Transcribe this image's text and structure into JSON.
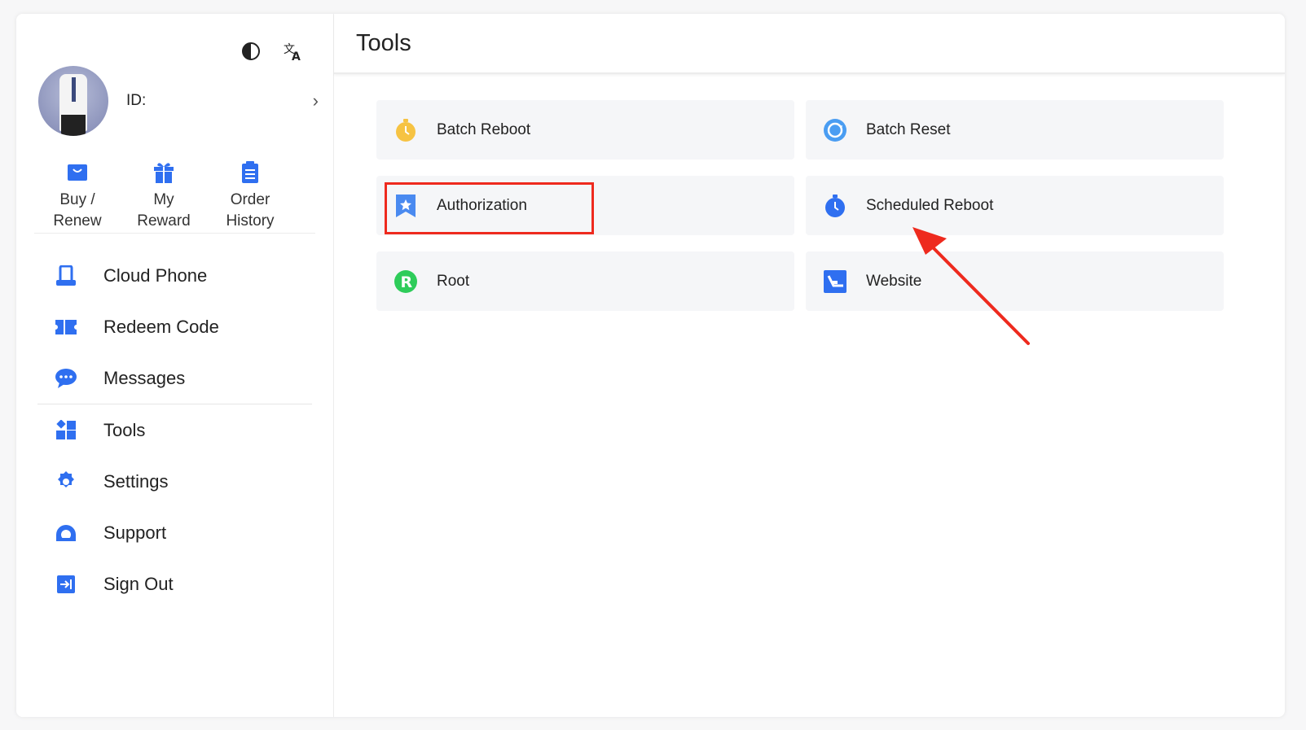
{
  "sidebar": {
    "profile": {
      "id_label": "ID:"
    },
    "quick_actions": [
      {
        "label": "Buy /\nRenew",
        "icon": "shopping-bag-icon"
      },
      {
        "label": "My\nReward",
        "icon": "gift-icon"
      },
      {
        "label": "Order\nHistory",
        "icon": "document-icon"
      }
    ],
    "menu": [
      {
        "label": "Cloud Phone",
        "icon": "cloud-phone-icon"
      },
      {
        "label": "Redeem Code",
        "icon": "ticket-icon"
      },
      {
        "label": "Messages",
        "icon": "chat-bubble-icon"
      },
      {
        "label": "Tools",
        "icon": "tools-grid-icon"
      },
      {
        "label": "Settings",
        "icon": "gear-icon"
      },
      {
        "label": "Support",
        "icon": "headset-icon"
      },
      {
        "label": "Sign Out",
        "icon": "sign-out-icon"
      }
    ],
    "top_icons": [
      "theme-contrast-icon",
      "translate-icon"
    ]
  },
  "main": {
    "title": "Tools",
    "tools": [
      {
        "label": "Batch Reboot",
        "icon": "timer-icon"
      },
      {
        "label": "Batch Reset",
        "icon": "refresh-icon"
      },
      {
        "label": "Authorization",
        "icon": "bookmark-star-icon",
        "highlighted": true
      },
      {
        "label": "Scheduled Reboot",
        "icon": "clock-icon"
      },
      {
        "label": "Root",
        "icon": "root-r-icon"
      },
      {
        "label": "Website",
        "icon": "website-icon"
      }
    ]
  },
  "colors": {
    "accent": "#2f6ff0",
    "highlight": "#ee2a1e",
    "card_bg": "#f5f6f8"
  }
}
